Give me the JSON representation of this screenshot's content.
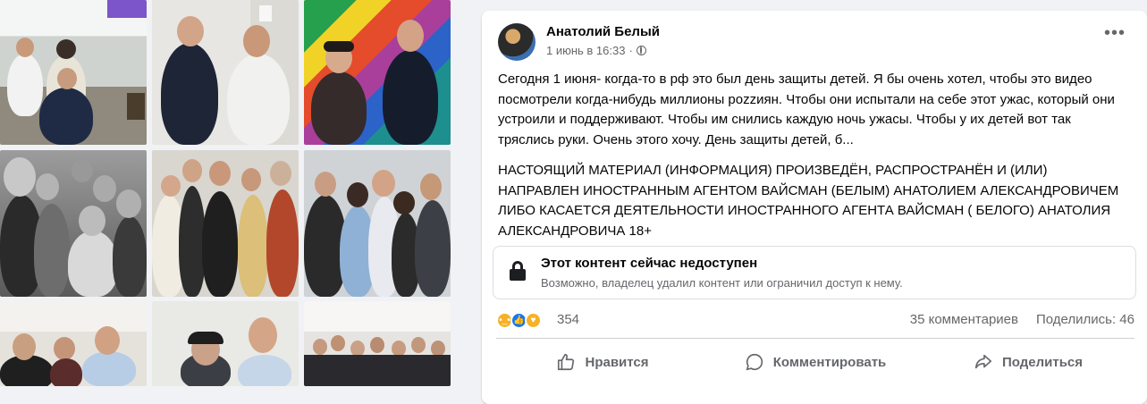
{
  "post": {
    "author": "Анатолий Белый",
    "timestamp": "1 июнь в 16:33",
    "separator": "·",
    "menu_glyph": "•••",
    "text_paragraph_1": "Сегодня 1 июня- когда-то в рф это был день защиты детей. Я бы очень хотел, чтобы это видео посмотрели когда-нибудь миллионы pozzиян. Чтобы они испытали на себе этот ужас, который они устроили и поддерживают. Чтобы им снились каждую ночь ужасы. Чтобы у их детей вот так тряслись руки. Очень этого хочу. День защиты детей, б...",
    "text_paragraph_2": "НАСТОЯЩИЙ МАТЕРИАЛ (ИНФОРМАЦИЯ) ПРОИЗВЕДЁН, РАСПРОСТРАНЁН И (ИЛИ) НАПРАВЛЕН ИНОСТРАННЫМ АГЕНТОМ ВАЙСМАН (БЕЛЫМ) АНАТОЛИЕМ АЛЕКСАНДРОВИЧЕМ ЛИБО КАСАЕТСЯ ДЕЯТЕЛЬНОСТИ ИНОСТРАННОГО АГЕНТА ВАЙСМАН ( БЕЛОГО) АНАТОЛИЯ АЛЕКСАНДРОВИЧА 18+"
  },
  "unavailable": {
    "title": "Этот контент сейчас недоступен",
    "subtitle": "Возможно, владелец удалил контент или ограничил доступ к нему.",
    "icon": "lock-icon"
  },
  "stats": {
    "reaction_count": "354",
    "comments": "35 комментариев",
    "shares": "Поделились: 46",
    "reactions": [
      "sad",
      "like",
      "care"
    ]
  },
  "actions": {
    "like": "Нравится",
    "comment": "Комментировать",
    "share": "Поделиться"
  },
  "colors": {
    "background": "#f0f2f5",
    "card": "#ffffff",
    "text": "#050505",
    "secondary": "#65676b",
    "like_blue": "#1877f2"
  }
}
